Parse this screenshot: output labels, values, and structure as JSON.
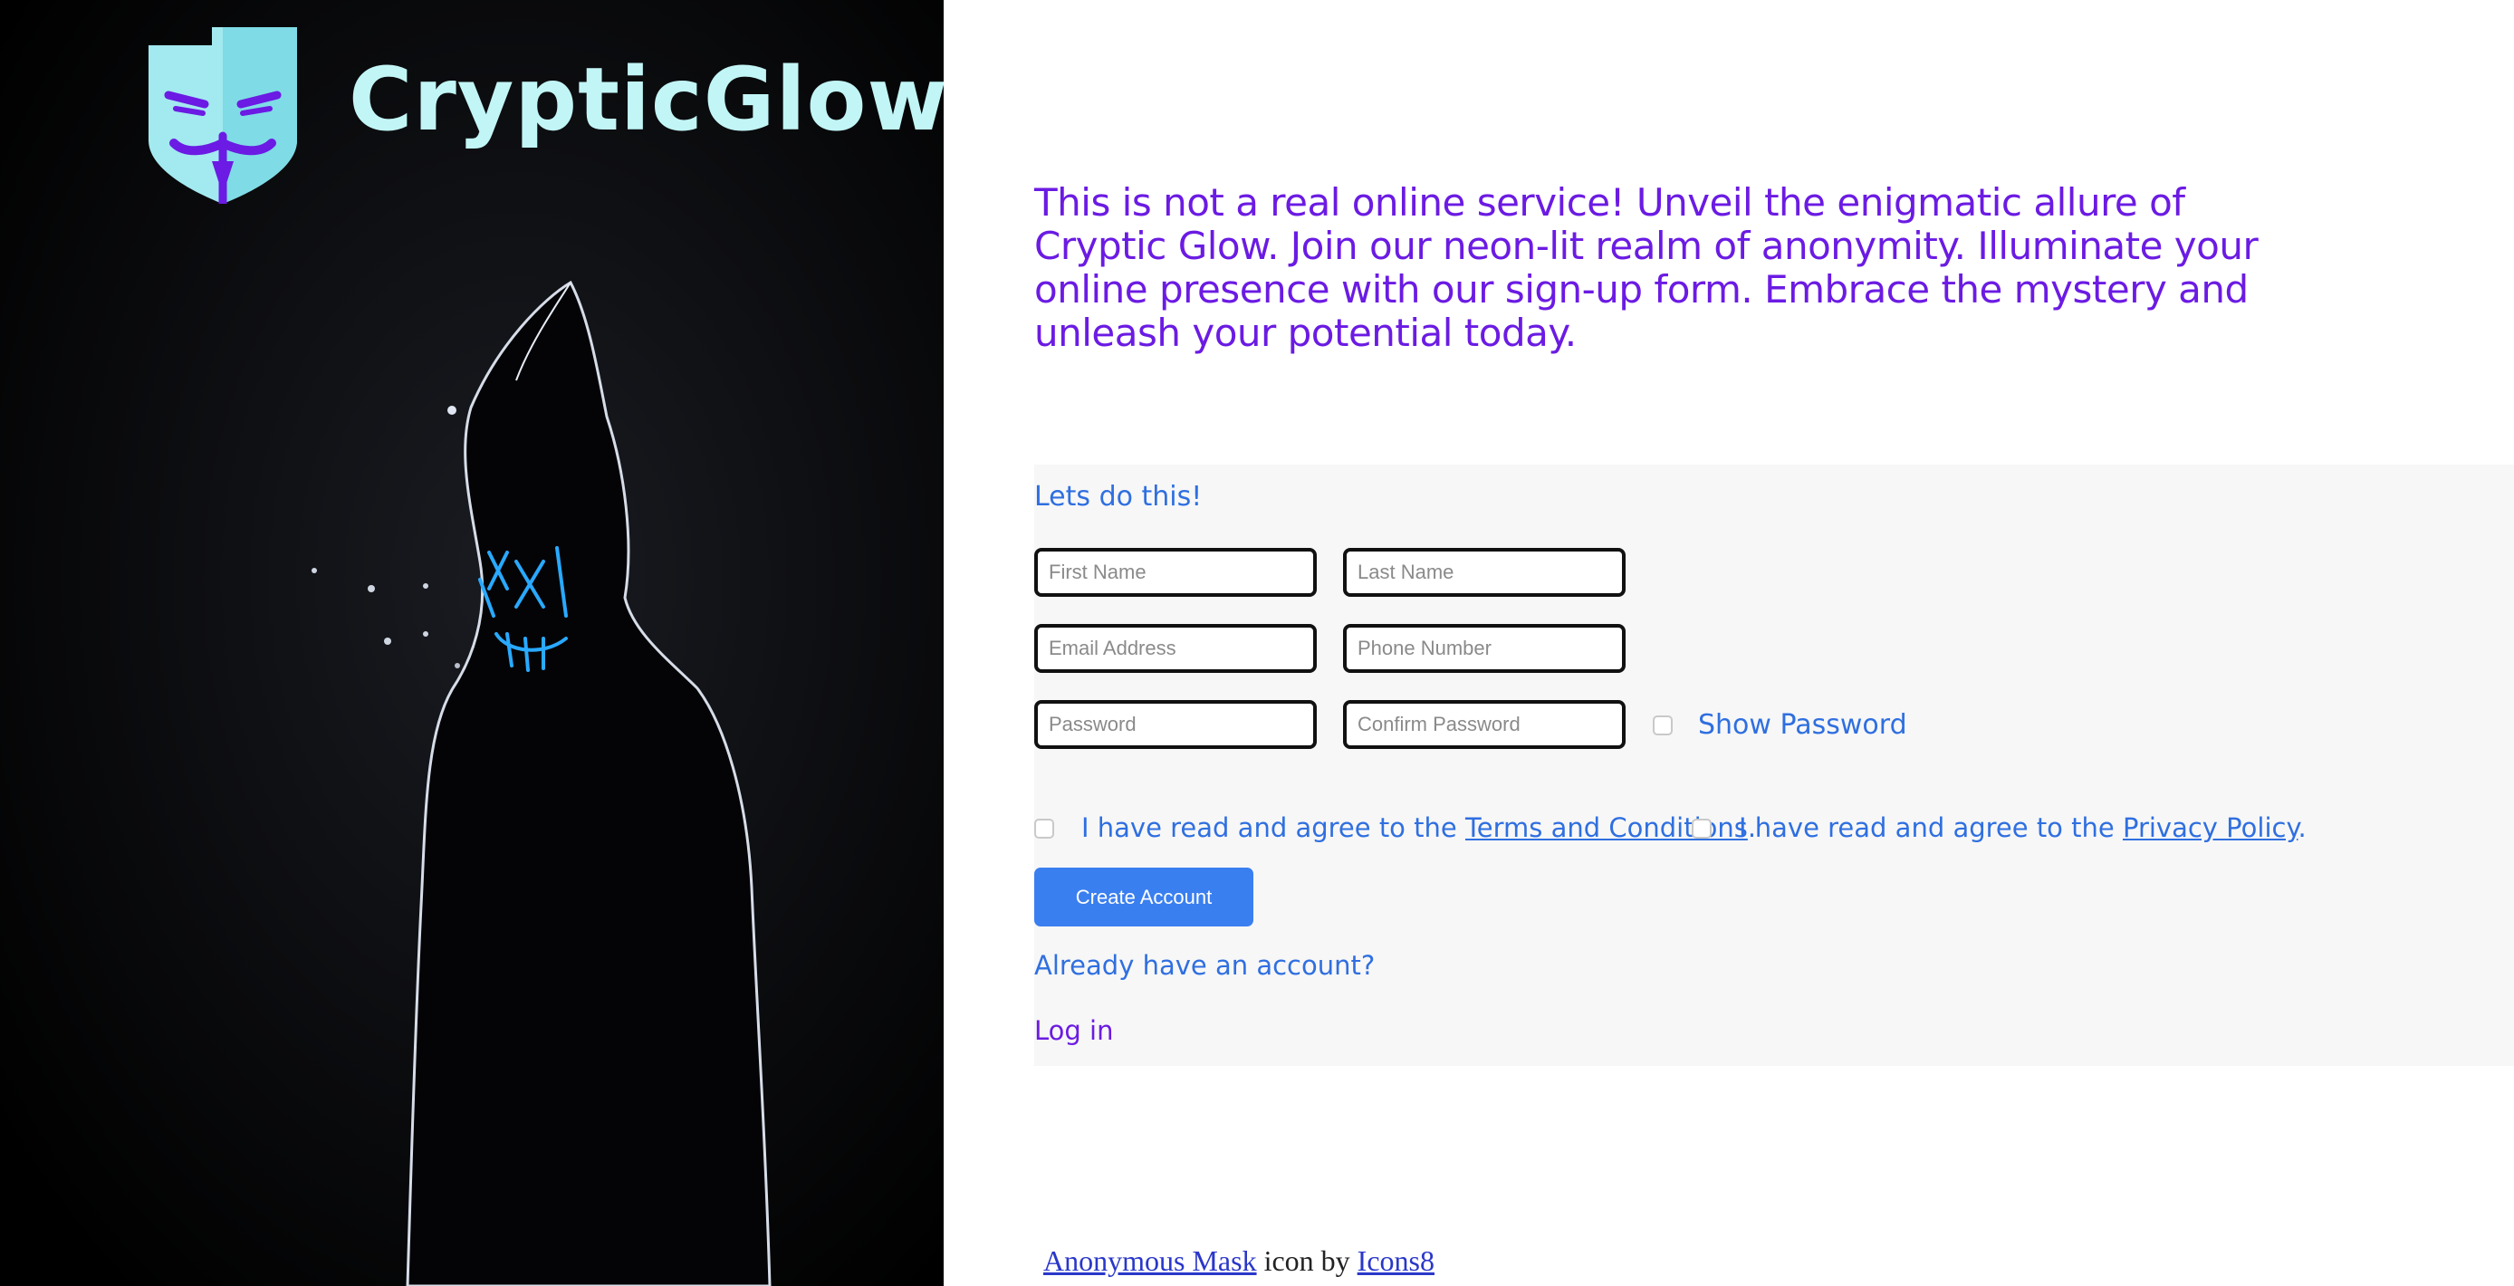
{
  "brand": {
    "name": "CrypticGlow",
    "logo_icon": "anonymous-mask-icon"
  },
  "intro_text": "This is not a real online service! Unveil the enigmatic allure of Cryptic Glow. Join our neon-lit realm of anonymity. Illuminate your online presence with our sign-up form. Embrace the mystery and unleash your potential today.",
  "form": {
    "heading": "Lets do this!",
    "first_name": {
      "placeholder": "First Name",
      "value": ""
    },
    "last_name": {
      "placeholder": "Last Name",
      "value": ""
    },
    "email": {
      "placeholder": "Email Address",
      "value": ""
    },
    "phone": {
      "placeholder": "Phone Number",
      "value": ""
    },
    "password": {
      "placeholder": "Password",
      "value": ""
    },
    "confirm_password": {
      "placeholder": "Confirm Password",
      "value": ""
    },
    "show_password_label": "Show Password",
    "terms": {
      "prefix": "I have read and agree to the ",
      "link": "Terms and Conditions",
      "suffix": "."
    },
    "privacy": {
      "prefix": "I have read and agree to the ",
      "link": "Privacy Policy",
      "suffix": "."
    },
    "submit_label": "Create Account",
    "already_text": "Already have an account?",
    "login_label": "Log in"
  },
  "credit": {
    "icon_link": "Anonymous Mask",
    "middle": " icon by ",
    "author_link": "Icons8"
  },
  "colors": {
    "accent_purple": "#6b1be3",
    "accent_blue": "#2f6fe0",
    "button_blue": "#3a7ff0",
    "brand_cyan": "#c2f5f6",
    "hero_bg": "#000000"
  }
}
